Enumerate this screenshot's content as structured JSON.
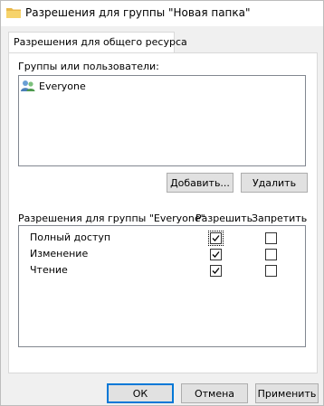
{
  "window": {
    "title": "Разрешения для группы \"Новая папка\""
  },
  "tabs": [
    {
      "label": "Разрешения для общего ресурса"
    }
  ],
  "groups": {
    "label": "Группы или пользователи:",
    "items": [
      {
        "name": "Everyone",
        "icon": "users-icon"
      }
    ]
  },
  "buttons": {
    "add": "Добавить...",
    "remove": "Удалить",
    "ok": "ОК",
    "cancel": "Отмена",
    "apply": "Применить"
  },
  "permissions": {
    "header": "Разрешения для группы \"Everyone\"",
    "allow_header": "Разрешить",
    "deny_header": "Запретить",
    "rows": [
      {
        "name": "Полный доступ",
        "allow": true,
        "deny": false
      },
      {
        "name": "Изменение",
        "allow": true,
        "deny": false
      },
      {
        "name": "Чтение",
        "allow": true,
        "deny": false
      }
    ]
  }
}
